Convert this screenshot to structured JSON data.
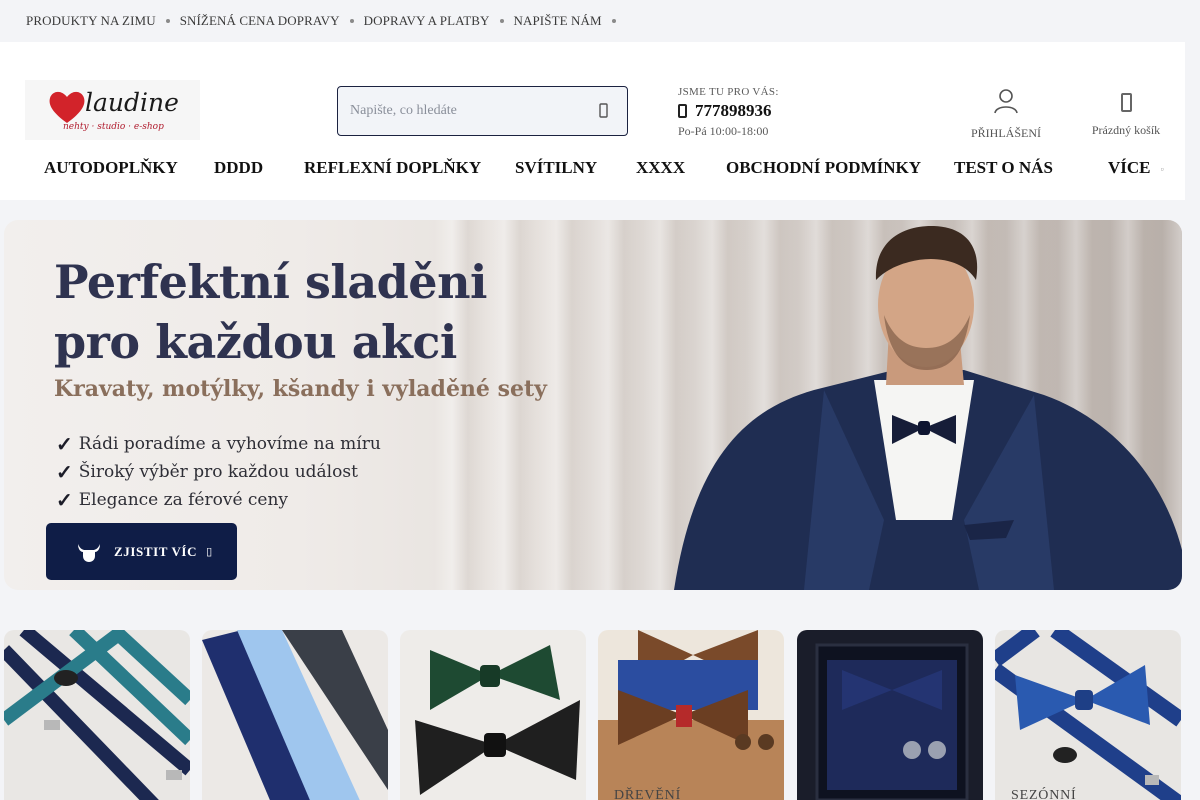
{
  "topbar": {
    "links": [
      "PRODUKTY NA ZIMU",
      "SNÍŽENÁ CENA DOPRAVY",
      "DOPRAVY A PLATBY",
      "NAPIŠTE NÁM"
    ]
  },
  "logo": {
    "brand": "laudine",
    "tagline": "nehty · studio · e-shop"
  },
  "search": {
    "placeholder": "Napište, co hledáte",
    "icon": "search-icon"
  },
  "contact": {
    "label": "JSME TU PRO VÁS:",
    "phone": "777898936",
    "hours": "Po-Pá 10:00-18:00"
  },
  "account": {
    "login_label": "PŘIHLÁŠENÍ",
    "cart_label": "Prázdný košík"
  },
  "nav": {
    "items": [
      "AUTODOPLŇKY",
      "DDDD",
      "REFLEXNÍ DOPLŇKY",
      "SVÍTILNY",
      "XXXX",
      "OBCHODNÍ PODMÍNKY",
      "TEST O NÁS",
      "VÍCE"
    ]
  },
  "hero": {
    "title_line1": "Perfektní sladěni",
    "title_line2": "pro každou akci",
    "subtitle": "Kravaty, motýlky, kšandy i vyladěné sety",
    "bullets": [
      "Rádi poradíme a vyhovíme na míru",
      "Široký výběr pro každou událost",
      "Elegance za férové ceny"
    ],
    "cta_label": "ZJISTIT VÍC"
  },
  "tiles": [
    {
      "caption": ""
    },
    {
      "caption": ""
    },
    {
      "caption": ""
    },
    {
      "caption": "DŘEVĚNÍ"
    },
    {
      "caption": ""
    },
    {
      "caption": "SEZÓNNÍ"
    }
  ],
  "colors": {
    "accent": "#0f1d47",
    "heading": "#2f3350",
    "subtitle": "#8a6f5c",
    "heart": "#d2232a"
  }
}
